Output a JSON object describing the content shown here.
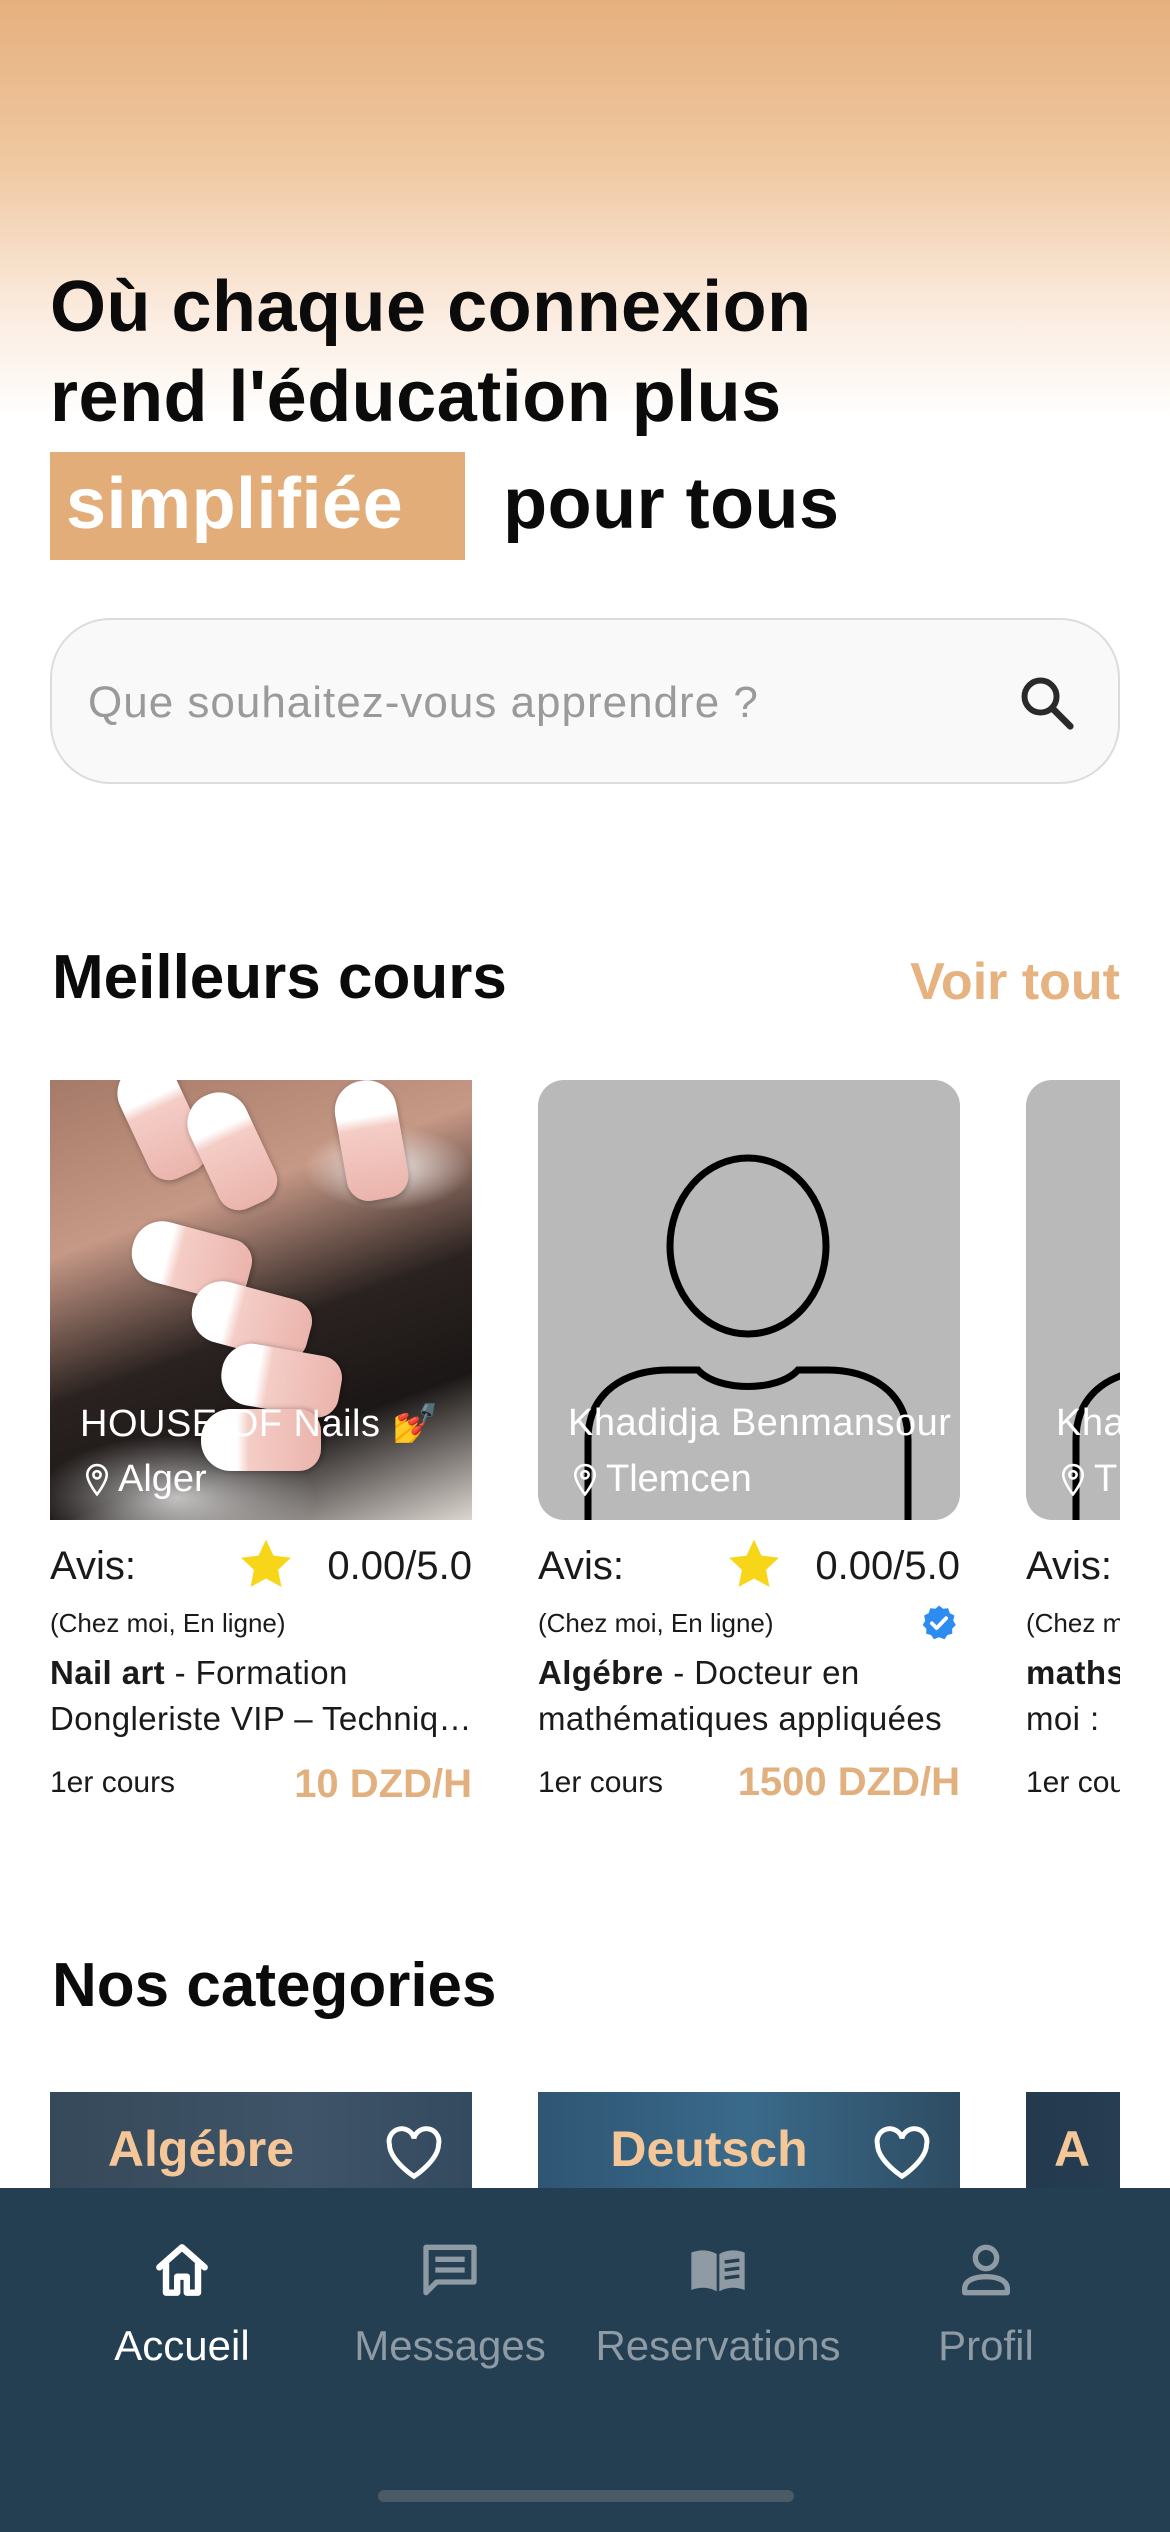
{
  "hero": {
    "line1": "Où chaque connexion",
    "line2": "rend l'éducation plus",
    "highlight": "simplifiée",
    "line3_rest": "pour tous"
  },
  "search": {
    "placeholder": "Que souhaitez-vous apprendre ?",
    "icon": "search-icon"
  },
  "best_courses": {
    "title": "Meilleurs cours",
    "see_all": "Voir tout",
    "cards": [
      {
        "name": "HOUSE OF Nails 💅",
        "location": "Alger",
        "avis_label": "Avis:",
        "rating": "0.00/5.0",
        "mode": "(Chez moi, En ligne)",
        "subject": "Nail art",
        "desc_line1": " - Formation",
        "desc_line2": "Dongleriste VIP – Techniques",
        "first_course": "1er cours",
        "price": "10 DZD/H"
      },
      {
        "name": "Khadidja Benmansour",
        "location": "Tlemcen",
        "avis_label": "Avis:",
        "rating": "0.00/5.0",
        "mode": "(Chez moi, En ligne)",
        "verified": true,
        "subject": "Algébre",
        "desc_line1": " - Docteur en",
        "desc_line2": "mathématiques appliquées",
        "first_course": "1er cours",
        "price": "1500 DZD/H"
      },
      {
        "name": "Kha",
        "location": "T",
        "avis_label": "Avis:",
        "mode": "(Chez m",
        "subject": "maths",
        "desc_line2": "moi :",
        "first_course": "1er cou"
      }
    ]
  },
  "categories": {
    "title": "Nos categories",
    "items": [
      {
        "label": "Algébre"
      },
      {
        "label": "Deutsch"
      },
      {
        "label": "A"
      }
    ]
  },
  "tabbar": {
    "tabs": [
      {
        "label": "Accueil",
        "icon": "home-icon",
        "active": true
      },
      {
        "label": "Messages",
        "icon": "message-icon"
      },
      {
        "label": "Reservations",
        "icon": "book-icon"
      },
      {
        "label": "Profil",
        "icon": "profile-icon"
      }
    ]
  },
  "colors": {
    "accent": "#e3ad7a",
    "price": "#e2b07f",
    "tabbar": "#253f52",
    "verified": "#2d8cf0",
    "star": "#f7d61a"
  }
}
